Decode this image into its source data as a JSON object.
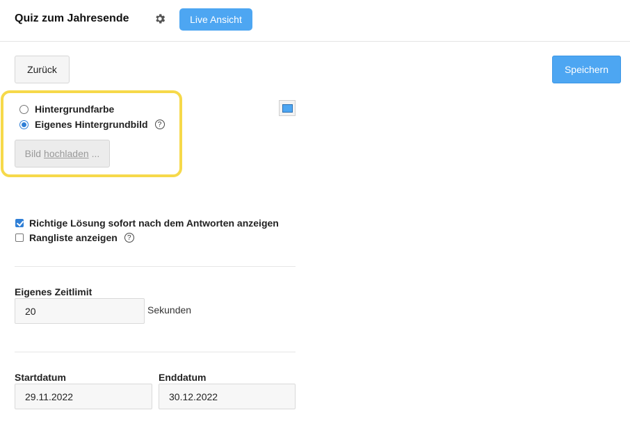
{
  "header": {
    "title": "Quiz zum Jahresende",
    "settings_icon": "gear-icon",
    "live_label": "Live Ansicht"
  },
  "toolbar": {
    "back_label": "Zurück",
    "save_label": "Speichern"
  },
  "background": {
    "option_color_label": "Hintergrundfarbe",
    "option_image_label": "Eigenes Hintergrundbild",
    "selected": "Eigenes Hintergrundbild",
    "help_icon": "help-icon",
    "upload_prefix": "Bild",
    "upload_link": "hochladen",
    "upload_suffix": "...",
    "color_value": "#4da6f2"
  },
  "options": {
    "show_solution_label": "Richtige Lösung sofort nach dem Antworten anzeigen",
    "show_solution_checked": true,
    "leaderboard_label": "Rangliste anzeigen",
    "leaderboard_checked": false
  },
  "time_limit": {
    "label": "Eigenes Zeitlimit",
    "value": "20",
    "unit": "Sekunden"
  },
  "dates": {
    "start_label": "Startdatum",
    "start_value": "29.11.2022",
    "end_label": "Enddatum",
    "end_value": "30.12.2022"
  },
  "colors": {
    "accent": "#4da6f2",
    "highlight": "#f6d94a"
  }
}
